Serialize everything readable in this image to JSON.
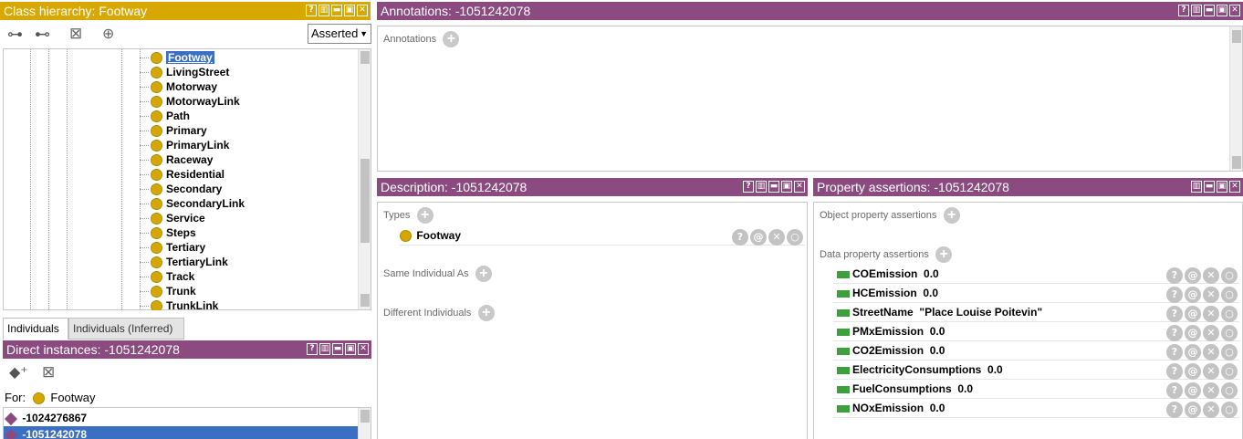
{
  "class_hierarchy": {
    "title": "Class hierarchy: Footway",
    "view_select": "Asserted",
    "items": [
      "Footway",
      "LivingStreet",
      "Motorway",
      "MotorwayLink",
      "Path",
      "Primary",
      "PrimaryLink",
      "Raceway",
      "Residential",
      "Secondary",
      "SecondaryLink",
      "Service",
      "Steps",
      "Tertiary",
      "TertiaryLink",
      "Track",
      "Trunk",
      "TrunkLink"
    ],
    "selected": "Footway"
  },
  "tabs": {
    "individuals": "Individuals",
    "individuals_inferred": "Individuals (Inferred)"
  },
  "direct_instances": {
    "title": "Direct instances: -1051242078",
    "for_label": "For:",
    "for_class": "Footway",
    "items": [
      "-1024276867",
      "-1051242078"
    ]
  },
  "annotations": {
    "title": "Annotations: -1051242078",
    "label": "Annotations"
  },
  "description": {
    "title": "Description: -1051242078",
    "types_label": "Types",
    "type_value": "Footway",
    "same_label": "Same Individual As",
    "different_label": "Different Individuals"
  },
  "property_assertions": {
    "title": "Property assertions: -1051242078",
    "object_label": "Object property assertions",
    "data_label": "Data property assertions",
    "rows": [
      {
        "name": "COEmission",
        "value": "0.0"
      },
      {
        "name": "HCEmission",
        "value": "0.0"
      },
      {
        "name": "StreetName",
        "value": "\"Place Louise Poitevin\""
      },
      {
        "name": "PMxEmission",
        "value": "0.0"
      },
      {
        "name": "CO2Emission",
        "value": "0.0"
      },
      {
        "name": "ElectricityConsumptions",
        "value": "0.0"
      },
      {
        "name": "FuelConsumptions",
        "value": "0.0"
      },
      {
        "name": "NOxEmission",
        "value": "0.0"
      }
    ]
  },
  "colors": {
    "gold_header": "#d8a800",
    "purple_header": "#8b4b80",
    "class_dot": "#d4a800",
    "data_bar": "#3da03d",
    "selection": "#3a6fc4"
  }
}
